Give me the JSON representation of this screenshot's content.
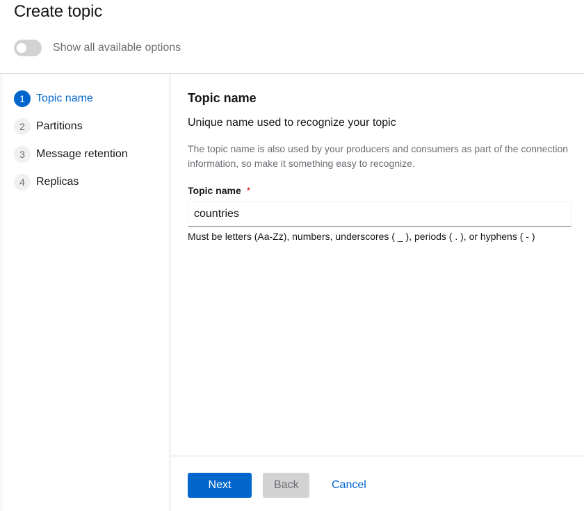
{
  "header": {
    "title": "Create topic",
    "toggle_label": "Show all available options",
    "toggle_on": false
  },
  "nav": {
    "items": [
      {
        "number": "1",
        "label": "Topic name",
        "current": true
      },
      {
        "number": "2",
        "label": "Partitions",
        "current": false
      },
      {
        "number": "3",
        "label": "Message retention",
        "current": false
      },
      {
        "number": "4",
        "label": "Replicas",
        "current": false
      }
    ]
  },
  "main": {
    "title": "Topic name",
    "subtitle": "Unique name used to recognize your topic",
    "help": "The topic name is also used by your producers and consumers as part of the connection information, so make it something easy to recognize.",
    "field": {
      "label": "Topic name",
      "required_mark": "*",
      "value": "countries",
      "helper": "Must be letters (Aa-Zz), numbers, underscores ( _ ), periods ( . ), or hyphens ( - )"
    }
  },
  "footer": {
    "next_label": "Next",
    "back_label": "Back",
    "cancel_label": "Cancel"
  },
  "colors": {
    "accent": "#0066cc",
    "disabled_bg": "#d2d2d2",
    "required": "#c9190b"
  }
}
